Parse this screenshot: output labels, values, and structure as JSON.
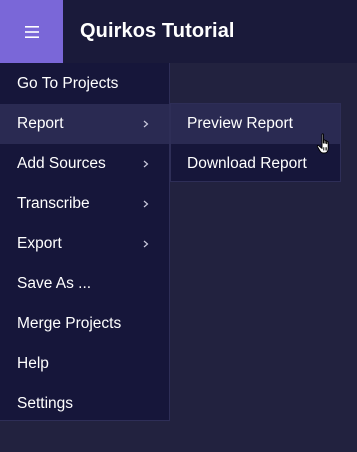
{
  "header": {
    "title": "Quirkos Tutorial",
    "menu_button_icon": "hamburger-icon",
    "accent_color": "#7a67d8",
    "background_color": "#1a1a3a"
  },
  "main_menu": {
    "items": [
      {
        "label": "Go To Projects",
        "has_submenu": false
      },
      {
        "label": "Report",
        "has_submenu": true,
        "active": true
      },
      {
        "label": "Add Sources",
        "has_submenu": true
      },
      {
        "label": "Transcribe",
        "has_submenu": true
      },
      {
        "label": "Export",
        "has_submenu": true
      },
      {
        "label": "Save As ...",
        "has_submenu": false
      },
      {
        "label": "Merge Projects",
        "has_submenu": false
      },
      {
        "label": "Help",
        "has_submenu": false
      },
      {
        "label": "Settings",
        "has_submenu": false
      }
    ]
  },
  "submenu": {
    "parent": "Report",
    "items": [
      {
        "label": "Preview Report",
        "hovered": true
      },
      {
        "label": "Download Report",
        "hovered": false
      }
    ]
  },
  "cursor": {
    "icon": "hand-pointer-icon"
  }
}
